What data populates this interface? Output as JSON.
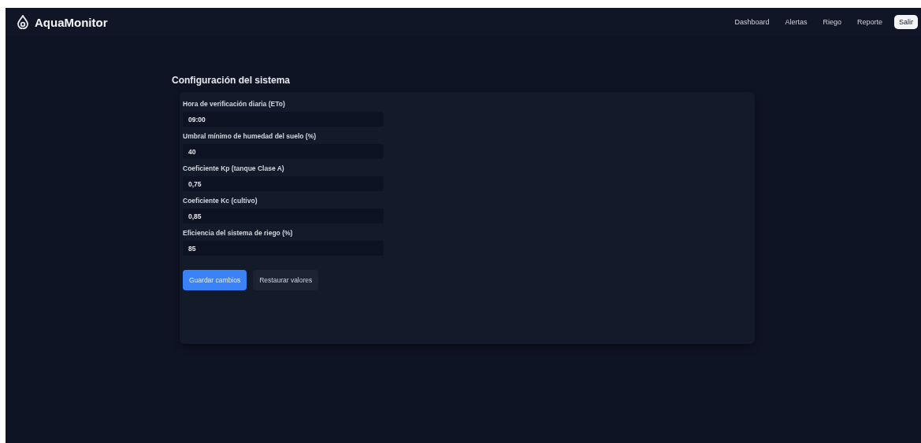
{
  "app": {
    "name": "AquaMonitor"
  },
  "nav": [
    {
      "label": "Dashboard"
    },
    {
      "label": "Alertas"
    },
    {
      "label": "Riego"
    },
    {
      "label": "Reporte"
    }
  ],
  "logout": {
    "label": "Salir"
  },
  "page": {
    "title": "Configuración del sistema"
  },
  "fields": [
    {
      "label": "Hora de verificación diaria (ETo)",
      "value": "09:00"
    },
    {
      "label": "Umbral mínimo de humedad del suelo (%)",
      "value": "40"
    },
    {
      "label": "Coeficiente Kp (tanque Clase A)",
      "value": "0,75"
    },
    {
      "label": "Coeficiente Kc (cultivo)",
      "value": "0,85"
    },
    {
      "label": "Eficiencia del sistema de riego (%)",
      "value": "85"
    }
  ],
  "buttons": [
    {
      "label": "Guardar cambios",
      "kind": "primary"
    },
    {
      "label": "Restaurar valores",
      "kind": "secondary"
    }
  ]
}
